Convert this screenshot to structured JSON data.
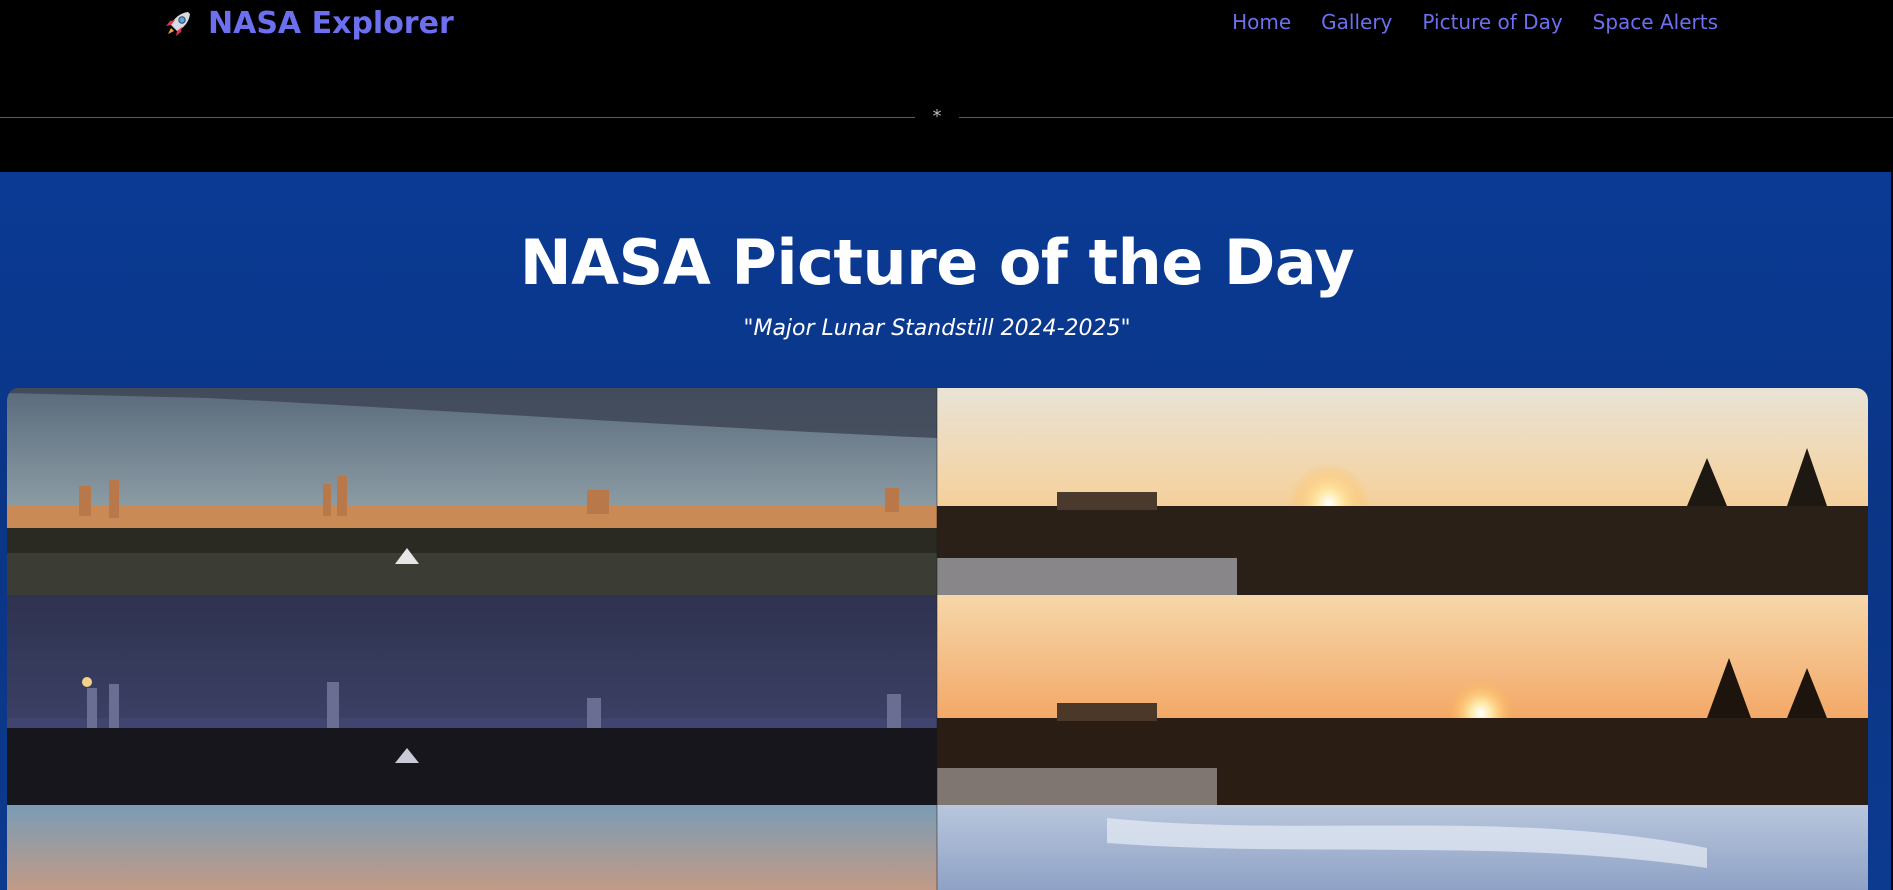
{
  "navbar": {
    "brand_icon": "rocket-icon",
    "brand_label": "NASA Explorer",
    "links": [
      {
        "label": "Home"
      },
      {
        "label": "Gallery"
      },
      {
        "label": "Picture of Day"
      },
      {
        "label": "Space Alerts"
      }
    ],
    "divider_symbol": "*"
  },
  "hero": {
    "title": "NASA Picture of the Day",
    "subtitle": "\"Major Lunar Standstill 2024-2025\""
  },
  "colors": {
    "link": "#6b6ff0",
    "background": "#000000",
    "hero_blue": "#0b3585",
    "text": "#ffffff"
  }
}
